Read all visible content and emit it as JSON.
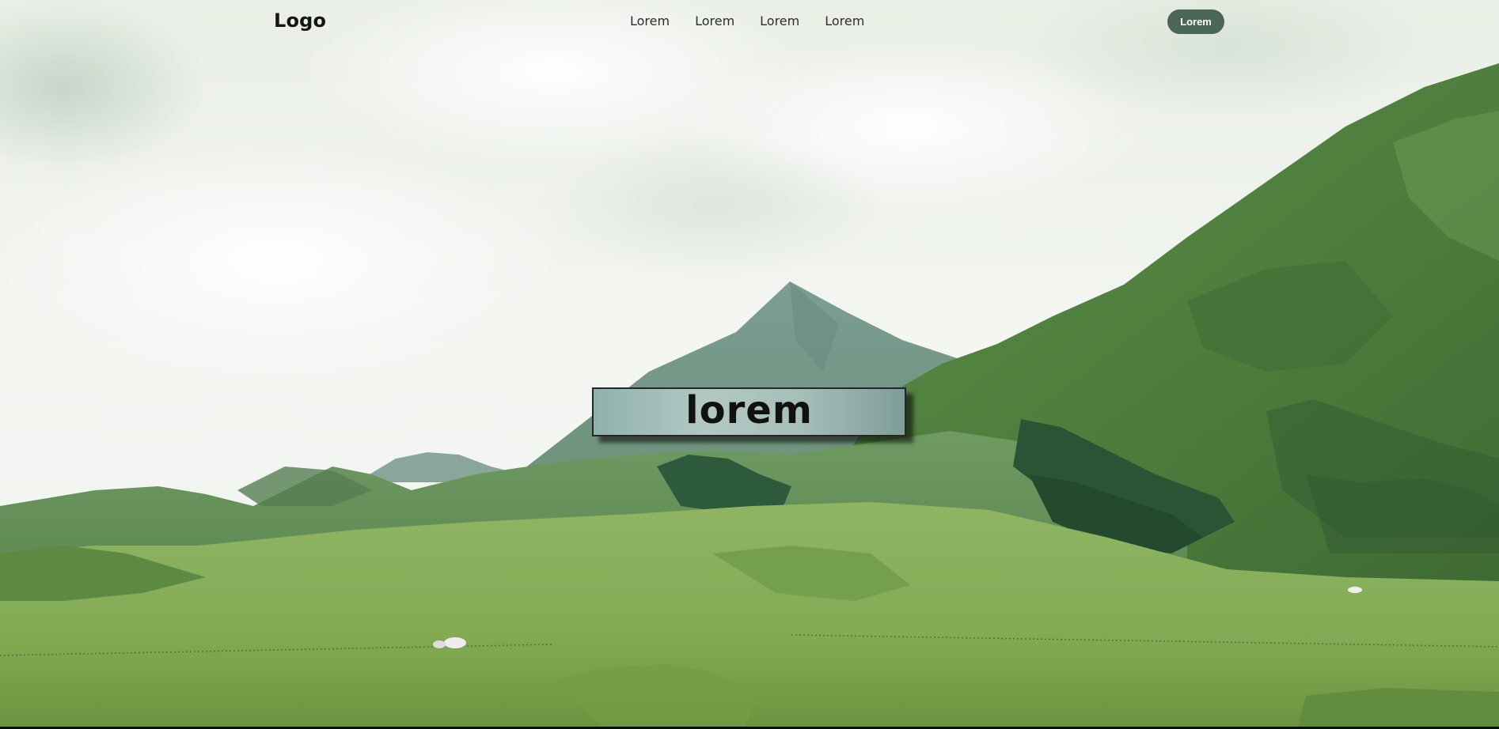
{
  "header": {
    "logo": "Logo",
    "nav": [
      "Lorem",
      "Lorem",
      "Lorem",
      "Lorem"
    ],
    "cta_label": "Lorem"
  },
  "hero": {
    "title": "lorem"
  },
  "colors": {
    "cta_background": "#4c6657",
    "hero_box_fill": "#a9bfba",
    "grass": "#7ea64e",
    "mountain": "#5a8f4a"
  }
}
